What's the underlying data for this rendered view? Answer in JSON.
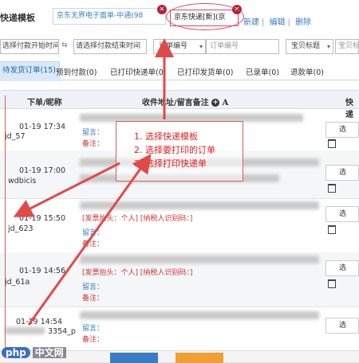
{
  "header": {
    "title": "快递模板",
    "template_name": "京东无界电子面单-中通",
    "template_count": "98",
    "selected_template": "京东快递[新]",
    "selected_suffix": "京",
    "badge_close": "✕",
    "links": [
      "新建",
      "编辑",
      "删除"
    ],
    "separator": "|"
  },
  "filters": {
    "pay_start": "选择付款开始时间",
    "pay_end": "请选择付款结束时间",
    "order_type": "订单编号",
    "order_input": "订单编号",
    "title_sel": "宝贝标题",
    "title_input": "宝贝标"
  },
  "tabs": [
    {
      "label": "待发货订单(15)",
      "active": true
    },
    {
      "label": "预到付款(0)"
    },
    {
      "label": "已打印快递单(0)"
    },
    {
      "label": "已打印发货单(0)"
    },
    {
      "label": "已录单(0)"
    },
    {
      "label": "退款单(0)"
    }
  ],
  "table": {
    "col_buyer": "下单/昵称",
    "col_address": "收件地址/留言备注",
    "col_font": "A",
    "col_ship": "快递",
    "rows": [
      {
        "date": "01-19 17:34",
        "buyer": "jd_57",
        "msg": "留言：",
        "remark": "备注：",
        "invoice": ""
      },
      {
        "date": "01-19 17:00",
        "buyer": "wdbicis",
        "msg": "",
        "remark": "",
        "invoice": ""
      },
      {
        "date": "01-19 15:50",
        "buyer": "jd_623",
        "msg": "留言：",
        "remark": "备注：",
        "invoice": "[发票抬头：个人]  [纳税人识别码：]"
      },
      {
        "date": "01-19 14:56",
        "buyer": "jd_61a",
        "msg": "留言：",
        "remark": "备注：",
        "invoice": "[发票抬头：个人]  [纳税人识别码：]"
      },
      {
        "date": "01-19 14:54",
        "buyer": "3354_p",
        "msg": "留言：",
        "remark": "备注：",
        "invoice": ""
      }
    ],
    "select_label": "选"
  },
  "instructions": [
    "1. 选择快递模板",
    "2. 选择要打印的订单",
    "3. 选择打印快递单"
  ],
  "watermark": {
    "badge": "php",
    "text": "中文网"
  },
  "colors": {
    "accent_blue": "#3a7cc2",
    "annotation_red": "#e05a5a",
    "tab_active_bg": "#dbe9f7"
  }
}
